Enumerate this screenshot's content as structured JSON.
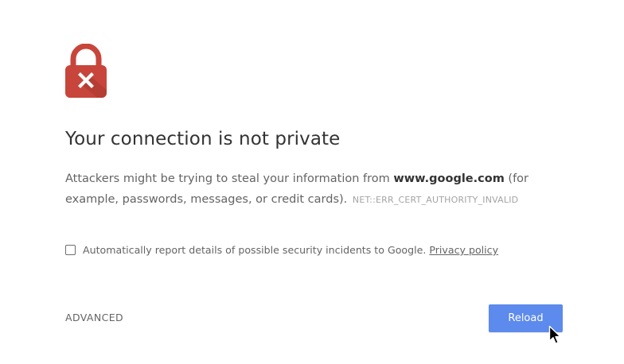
{
  "interstitial": {
    "title": "Your connection is not private",
    "body_prefix": "Attackers might be trying to steal your information from ",
    "host": "www.google.com",
    "body_suffix": " (for example, passwords, messages, or credit cards).",
    "error_code": "NET::ERR_CERT_AUTHORITY_INVALID",
    "lock_icon": "lock-error-icon",
    "lock_color": "#C8453B"
  },
  "report": {
    "checkbox_checked": false,
    "label": "Automatically report details of possible security incidents to Google.",
    "privacy_link": "Privacy policy"
  },
  "actions": {
    "advanced_label": "ADVANCED",
    "reload_label": "Reload",
    "reload_color": "#5C8AED"
  },
  "cursor": {
    "icon": "mouse-pointer-icon"
  }
}
